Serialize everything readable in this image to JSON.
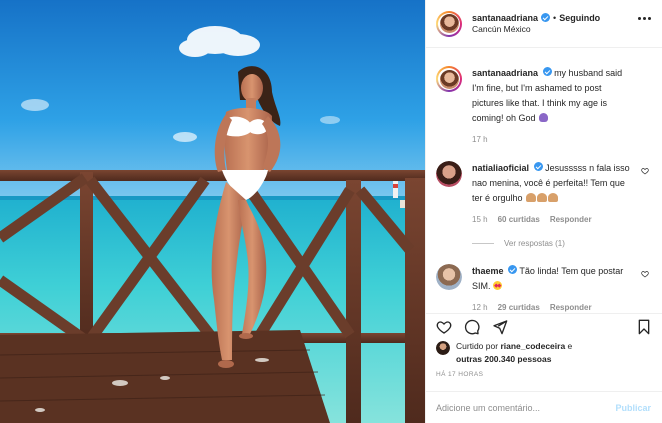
{
  "post": {
    "author": "santanaadriana",
    "follow_status": "Seguindo",
    "location": "Cancún México",
    "separator": "•"
  },
  "caption": {
    "username": "santanaadriana",
    "text": "my husband said I'm fine, but I'm ashamed to post pictures like that. I think my age is coming! oh God",
    "emoji": "woman-gesturing-icon",
    "time": "17 h"
  },
  "comments": [
    {
      "username": "natialiaoficial",
      "text": "Jesusssss n fala isso nao menina, você é perfeita!! Tem que ter é orgulho",
      "emoji": "folded-hands-icon",
      "time": "15 h",
      "likes": "60 curtidas",
      "reply": "Responder",
      "view_replies": "Ver respostas (1)"
    },
    {
      "username": "thaeme",
      "text": "Tão linda! Tem que postar SIM.",
      "emoji": "star-struck-icon",
      "time": "12 h",
      "likes": "29 curtidas",
      "reply": "Responder"
    }
  ],
  "likes": {
    "prefix": "Curtido por",
    "liker": "riane_codeceira",
    "joiner": "e",
    "others": "outras 200.340 pessoas"
  },
  "timestamp": "HÁ 17 HORAS",
  "add_comment": {
    "placeholder": "Adicione um comentário...",
    "publish_label": "Publicar"
  },
  "colors": {
    "verified": "#3897f0",
    "publish_disabled": "#b2dffc",
    "muted_text": "#8e8e8e",
    "sky": "#1f88d6",
    "sea": "#35c3d6",
    "deck": "#6b3d2b"
  },
  "icons": [
    "like-icon",
    "comment-icon",
    "share-icon",
    "save-icon",
    "more-options-icon",
    "verified-badge-icon",
    "heart-icon"
  ]
}
